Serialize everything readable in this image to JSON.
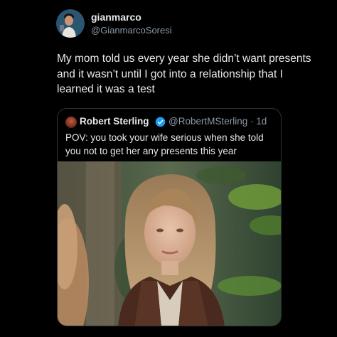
{
  "author": {
    "name": "gianmarco",
    "handle": "@GianmarcoSoresi",
    "avatar_icon": "profile-photo"
  },
  "tweet": {
    "text": "My mom told us every year she didn’t want presents and it wasn’t until I got into a relationship that I learned it was a test"
  },
  "quoted": {
    "name": "Robert Sterling",
    "verified_icon": "verified-badge-icon",
    "handle_time": "@RobertMSterling · 1d",
    "text": "POV: you took your wife serious when she told you not to get her any presents this year",
    "media_alt": "photo-woman-brown-leather-jacket-among-plants"
  },
  "colors": {
    "background": "#000000",
    "text": "#e7e9ea",
    "secondary": "#8b98a5",
    "border": "#2f3336",
    "verified": "#1d9bf0"
  }
}
